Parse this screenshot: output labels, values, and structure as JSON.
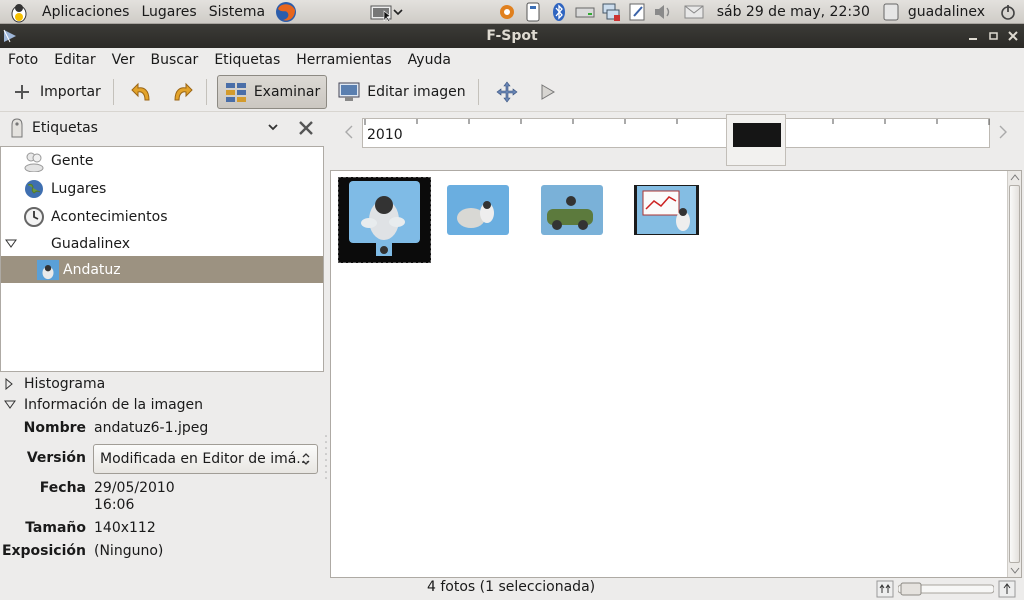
{
  "panel": {
    "menus": [
      "Aplicaciones",
      "Lugares",
      "Sistema"
    ],
    "clock": "sáb 29 de may, 22:30",
    "user": "guadalinex"
  },
  "window": {
    "title": "F-Spot"
  },
  "menubar": [
    "Foto",
    "Editar",
    "Ver",
    "Buscar",
    "Etiquetas",
    "Herramientas",
    "Ayuda"
  ],
  "toolbar": {
    "import": "Importar",
    "browse": "Examinar",
    "edit_image": "Editar imagen"
  },
  "tags": {
    "header": "Etiquetas",
    "items": [
      {
        "label": "Gente",
        "icon": "people-icon"
      },
      {
        "label": "Lugares",
        "icon": "globe-icon"
      },
      {
        "label": "Acontecimientos",
        "icon": "clock-icon"
      },
      {
        "label": "Guadalinex",
        "icon": ""
      },
      {
        "label": "Andatuz",
        "icon": "photo-tag-icon"
      }
    ]
  },
  "sections": {
    "histogram": "Histograma",
    "info": "Información de la imagen"
  },
  "info": {
    "name_key": "Nombre",
    "name_val": "andatuz6-1.jpeg",
    "version_key": "Versión",
    "version_val": "Modificada en Editor de imá...",
    "date_key": "Fecha",
    "date_val": "29/05/2010",
    "time_val": "16:06",
    "size_key": "Tamaño",
    "size_val": "140x112",
    "exposure_key": "Exposición",
    "exposure_val": "(Ninguno)"
  },
  "timeline": {
    "year": "2010"
  },
  "status": {
    "text": "4 fotos (1 seleccionada)"
  },
  "colors": {
    "selection": "#9c9281",
    "titlebar": "#3c3b37",
    "accent": "#f07746"
  }
}
